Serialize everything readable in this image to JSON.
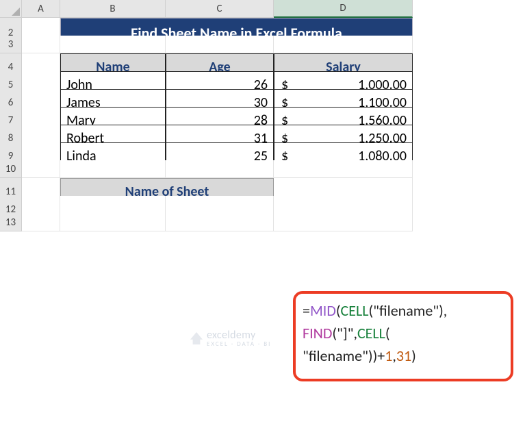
{
  "columns": [
    "A",
    "B",
    "C",
    "D"
  ],
  "rows": [
    "2",
    "3",
    "4",
    "5",
    "6",
    "7",
    "8",
    "9",
    "10",
    "11",
    "12",
    "13"
  ],
  "title": "Find Sheet Name in Excel Formula",
  "headers": {
    "name": "Name",
    "age": "Age",
    "salary": "Salary"
  },
  "data": [
    {
      "name": "John",
      "age": "26",
      "sym": "$",
      "salary": "1,000.00"
    },
    {
      "name": "James",
      "age": "30",
      "sym": "$",
      "salary": "1,100.00"
    },
    {
      "name": "Mary",
      "age": "28",
      "sym": "$",
      "salary": "1,560.00"
    },
    {
      "name": "Robert",
      "age": "31",
      "sym": "$",
      "salary": "1,250.00"
    },
    {
      "name": "Linda",
      "age": "25",
      "sym": "$",
      "salary": "1,080.00"
    }
  ],
  "sheetLabel": "Name of Sheet",
  "formula": {
    "l1a": "=",
    "l1b": "MID",
    "l1c": "(",
    "l1d": "CELL",
    "l1e": "(\"filename\"),",
    "l2a": "FIND",
    "l2b": "(\"]\",",
    "l2c": "CELL",
    "l2d": "(",
    "l3a": "\"filename\"))+",
    "l3b": "1",
    "l3c": ",",
    "l3d": "31",
    "l3e": ")"
  },
  "watermark": {
    "brand": "exceldemy",
    "tag": "EXCEL · DATA · BI"
  },
  "activeCol": "D"
}
